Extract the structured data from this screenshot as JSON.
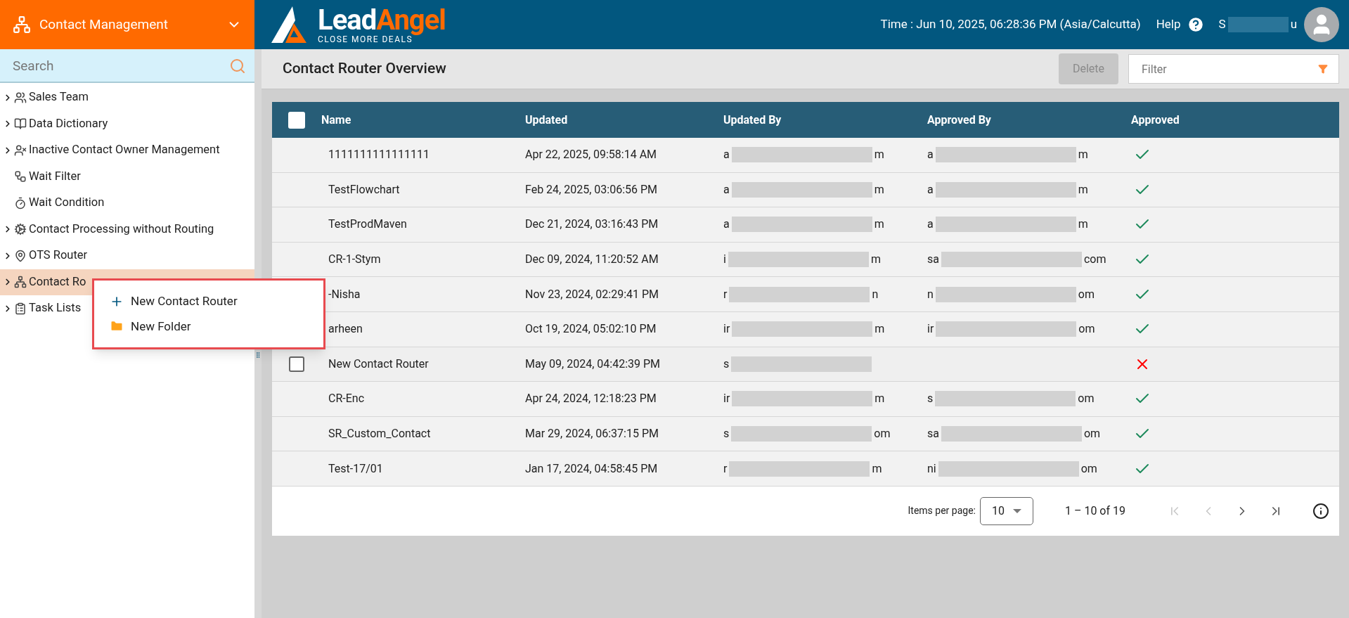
{
  "module": {
    "title": "Contact Management"
  },
  "logo": {
    "part1": "Lead",
    "part2": "Angel",
    "tagline": "CLOSE MORE DEALS"
  },
  "header": {
    "time": "Time : Jun 10, 2025, 06:28:36 PM (Asia/Calcutta)",
    "help": "Help",
    "user": {
      "prefix": "S",
      "suffix": "u"
    }
  },
  "search": {
    "placeholder": "Search"
  },
  "sidebar": {
    "items": [
      {
        "label": "Sales Team",
        "expandable": true,
        "selected": false
      },
      {
        "label": "Data Dictionary",
        "expandable": true,
        "selected": false
      },
      {
        "label": "Inactive Contact Owner Management",
        "expandable": true,
        "selected": false
      },
      {
        "label": "Wait Filter",
        "expandable": false,
        "selected": false
      },
      {
        "label": "Wait Condition",
        "expandable": false,
        "selected": false
      },
      {
        "label": "Contact Processing without Routing",
        "expandable": true,
        "selected": false
      },
      {
        "label": "OTS Router",
        "expandable": true,
        "selected": false
      },
      {
        "label": "Contact Ro",
        "expandable": true,
        "selected": true
      },
      {
        "label": "Task Lists",
        "expandable": true,
        "selected": false
      }
    ]
  },
  "context_menu": {
    "items": [
      {
        "label": "New Contact Router"
      },
      {
        "label": "New Folder"
      }
    ]
  },
  "page": {
    "title": "Contact Router Overview",
    "delete_button": {
      "label": "Delete",
      "disabled": true
    },
    "filter": {
      "placeholder": "Filter"
    }
  },
  "table": {
    "columns": [
      "Name",
      "Updated",
      "Updated By",
      "Approved By",
      "Approved"
    ],
    "header_checked": false,
    "rows": [
      {
        "name": "1111111111111111",
        "updated": "Apr 22, 2025, 09:58:14 AM",
        "updated_by": {
          "prefix": "a",
          "suffix": "m"
        },
        "approved_by": {
          "prefix": "a",
          "suffix": "m"
        },
        "approved": true,
        "hovered": false,
        "checked": false
      },
      {
        "name": "TestFlowchart",
        "updated": "Feb 24, 2025, 03:06:56 PM",
        "updated_by": {
          "prefix": "a",
          "suffix": "m"
        },
        "approved_by": {
          "prefix": "a",
          "suffix": "m"
        },
        "approved": true,
        "hovered": false,
        "checked": false
      },
      {
        "name": "TestProdMaven",
        "updated": "Dec 21, 2024, 03:16:43 PM",
        "updated_by": {
          "prefix": "a",
          "suffix": "m"
        },
        "approved_by": {
          "prefix": "a",
          "suffix": "m"
        },
        "approved": true,
        "hovered": false,
        "checked": false
      },
      {
        "name": "CR-1-Stym",
        "updated": "Dec 09, 2024, 11:20:52 AM",
        "updated_by": {
          "prefix": "i",
          "suffix": "m"
        },
        "approved_by": {
          "prefix": "sa",
          "suffix": "com"
        },
        "approved": true,
        "hovered": false,
        "checked": false
      },
      {
        "name": "-Nisha",
        "updated": "Nov 23, 2024, 02:29:41 PM",
        "updated_by": {
          "prefix": "r",
          "suffix": "n"
        },
        "approved_by": {
          "prefix": "n",
          "suffix": "om"
        },
        "approved": true,
        "hovered": false,
        "checked": false
      },
      {
        "name": "arheen",
        "updated": "Oct 19, 2024, 05:02:10 PM",
        "updated_by": {
          "prefix": "ir",
          "suffix": "m"
        },
        "approved_by": {
          "prefix": "ir",
          "suffix": "om"
        },
        "approved": true,
        "hovered": false,
        "checked": false
      },
      {
        "name": "New Contact Router",
        "updated": "May 09, 2024, 04:42:39 PM",
        "updated_by": {
          "prefix": "s"
        },
        "approved": false,
        "hovered": true,
        "checked": false
      },
      {
        "name": "CR-Enc",
        "updated": "Apr 24, 2024, 12:18:23 PM",
        "updated_by": {
          "prefix": "ir",
          "suffix": "m"
        },
        "approved_by": {
          "prefix": "s",
          "suffix": "om"
        },
        "approved": true,
        "hovered": false,
        "checked": false
      },
      {
        "name": "SR_Custom_Contact",
        "updated": "Mar 29, 2024, 06:37:15 PM",
        "updated_by": {
          "prefix": "s",
          "suffix": "om"
        },
        "approved_by": {
          "prefix": "sa",
          "suffix": "om"
        },
        "approved": true,
        "hovered": false,
        "checked": false
      },
      {
        "name": "Test-17/01",
        "updated": "Jan 17, 2024, 04:58:45 PM",
        "updated_by": {
          "prefix": "r",
          "suffix": "m"
        },
        "approved_by": {
          "prefix": "ni",
          "suffix": "om"
        },
        "approved": true,
        "hovered": false,
        "checked": false
      }
    ]
  },
  "paginator": {
    "label": "Items per page:",
    "page_size": "10",
    "range": "1 – 10 of 19",
    "first_disabled": true,
    "prev_disabled": true,
    "next_disabled": false,
    "last_disabled": false
  }
}
